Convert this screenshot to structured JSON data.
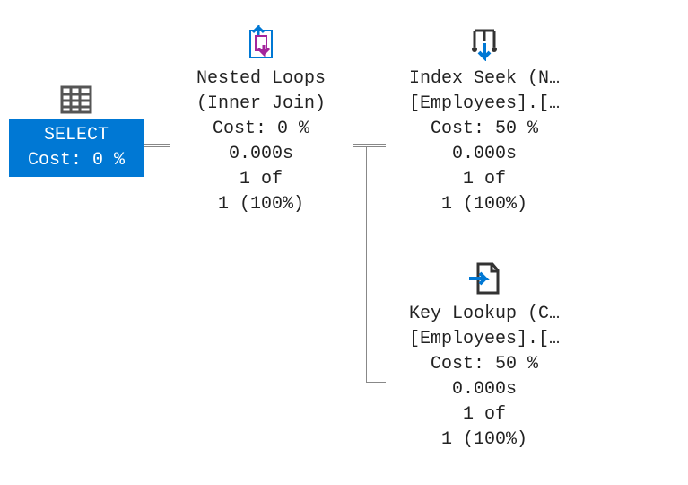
{
  "select": {
    "label": "SELECT",
    "cost": "Cost: 0 %"
  },
  "nested": {
    "title": "Nested Loops",
    "subtitle": "(Inner Join)",
    "cost": "Cost: 0 %",
    "time": "0.000s",
    "rows1": "1 of",
    "rows2": "1 (100%)"
  },
  "indexseek": {
    "title": "Index Seek (N…",
    "object": "[Employees].[…",
    "cost": "Cost: 50 %",
    "time": "0.000s",
    "rows1": "1 of",
    "rows2": "1 (100%)"
  },
  "keylookup": {
    "title": "Key Lookup (C…",
    "object": "[Employees].[…",
    "cost": "Cost: 50 %",
    "time": "0.000s",
    "rows1": "1 of",
    "rows2": "1 (100%)"
  }
}
